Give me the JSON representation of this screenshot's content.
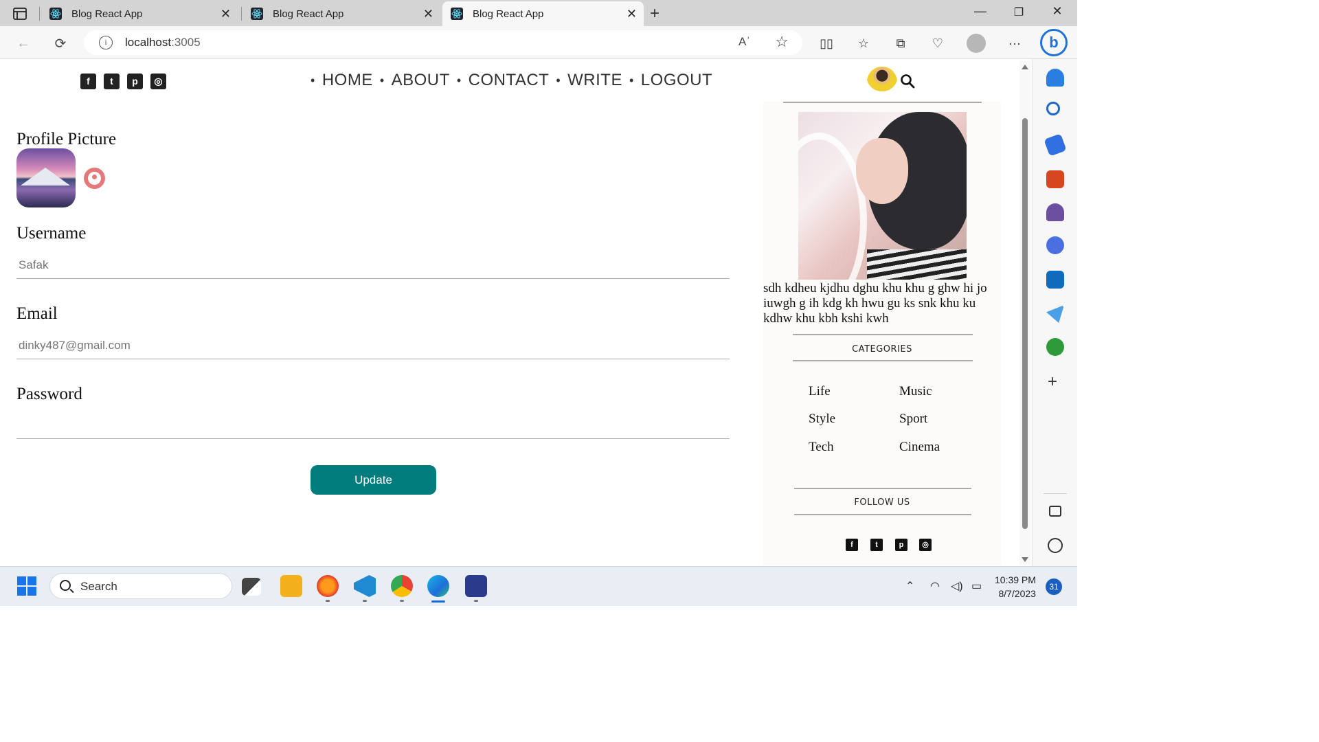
{
  "browser": {
    "tabs": [
      {
        "title": "Blog React App",
        "active": false
      },
      {
        "title": "Blog React App",
        "active": false
      },
      {
        "title": "Blog React App",
        "active": true
      }
    ],
    "url_host": "localhost",
    "url_port": ":3005",
    "read_aloud": "Aʾ"
  },
  "header": {
    "nav": [
      "HOME",
      "ABOUT",
      "CONTACT",
      "WRITE",
      "LOGOUT"
    ],
    "social_icons": [
      "facebook-icon",
      "twitter-icon",
      "pinterest-icon",
      "instagram-icon"
    ]
  },
  "form": {
    "profile_picture_label": "Profile Picture",
    "username_label": "Username",
    "username_value": "Safak",
    "email_label": "Email",
    "email_value": "dinky487@gmail.com",
    "password_label": "Password",
    "password_value": "",
    "update_button": "Update"
  },
  "sidebar": {
    "about_text": "sdh kdheu kjdhu dghu khu khu g ghw hi jo iuwgh g ih kdg kh hwu gu ks snk khu ku kdhw khu kbh kshi kwh",
    "categories_title": "CATEGORIES",
    "categories": [
      "Life",
      "Music",
      "Style",
      "Sport",
      "Tech",
      "Cinema"
    ],
    "follow_title": "FOLLOW US"
  },
  "taskbar": {
    "search_placeholder": "Search",
    "time": "10:39 PM",
    "date": "8/7/2023",
    "notification_count": "31"
  }
}
